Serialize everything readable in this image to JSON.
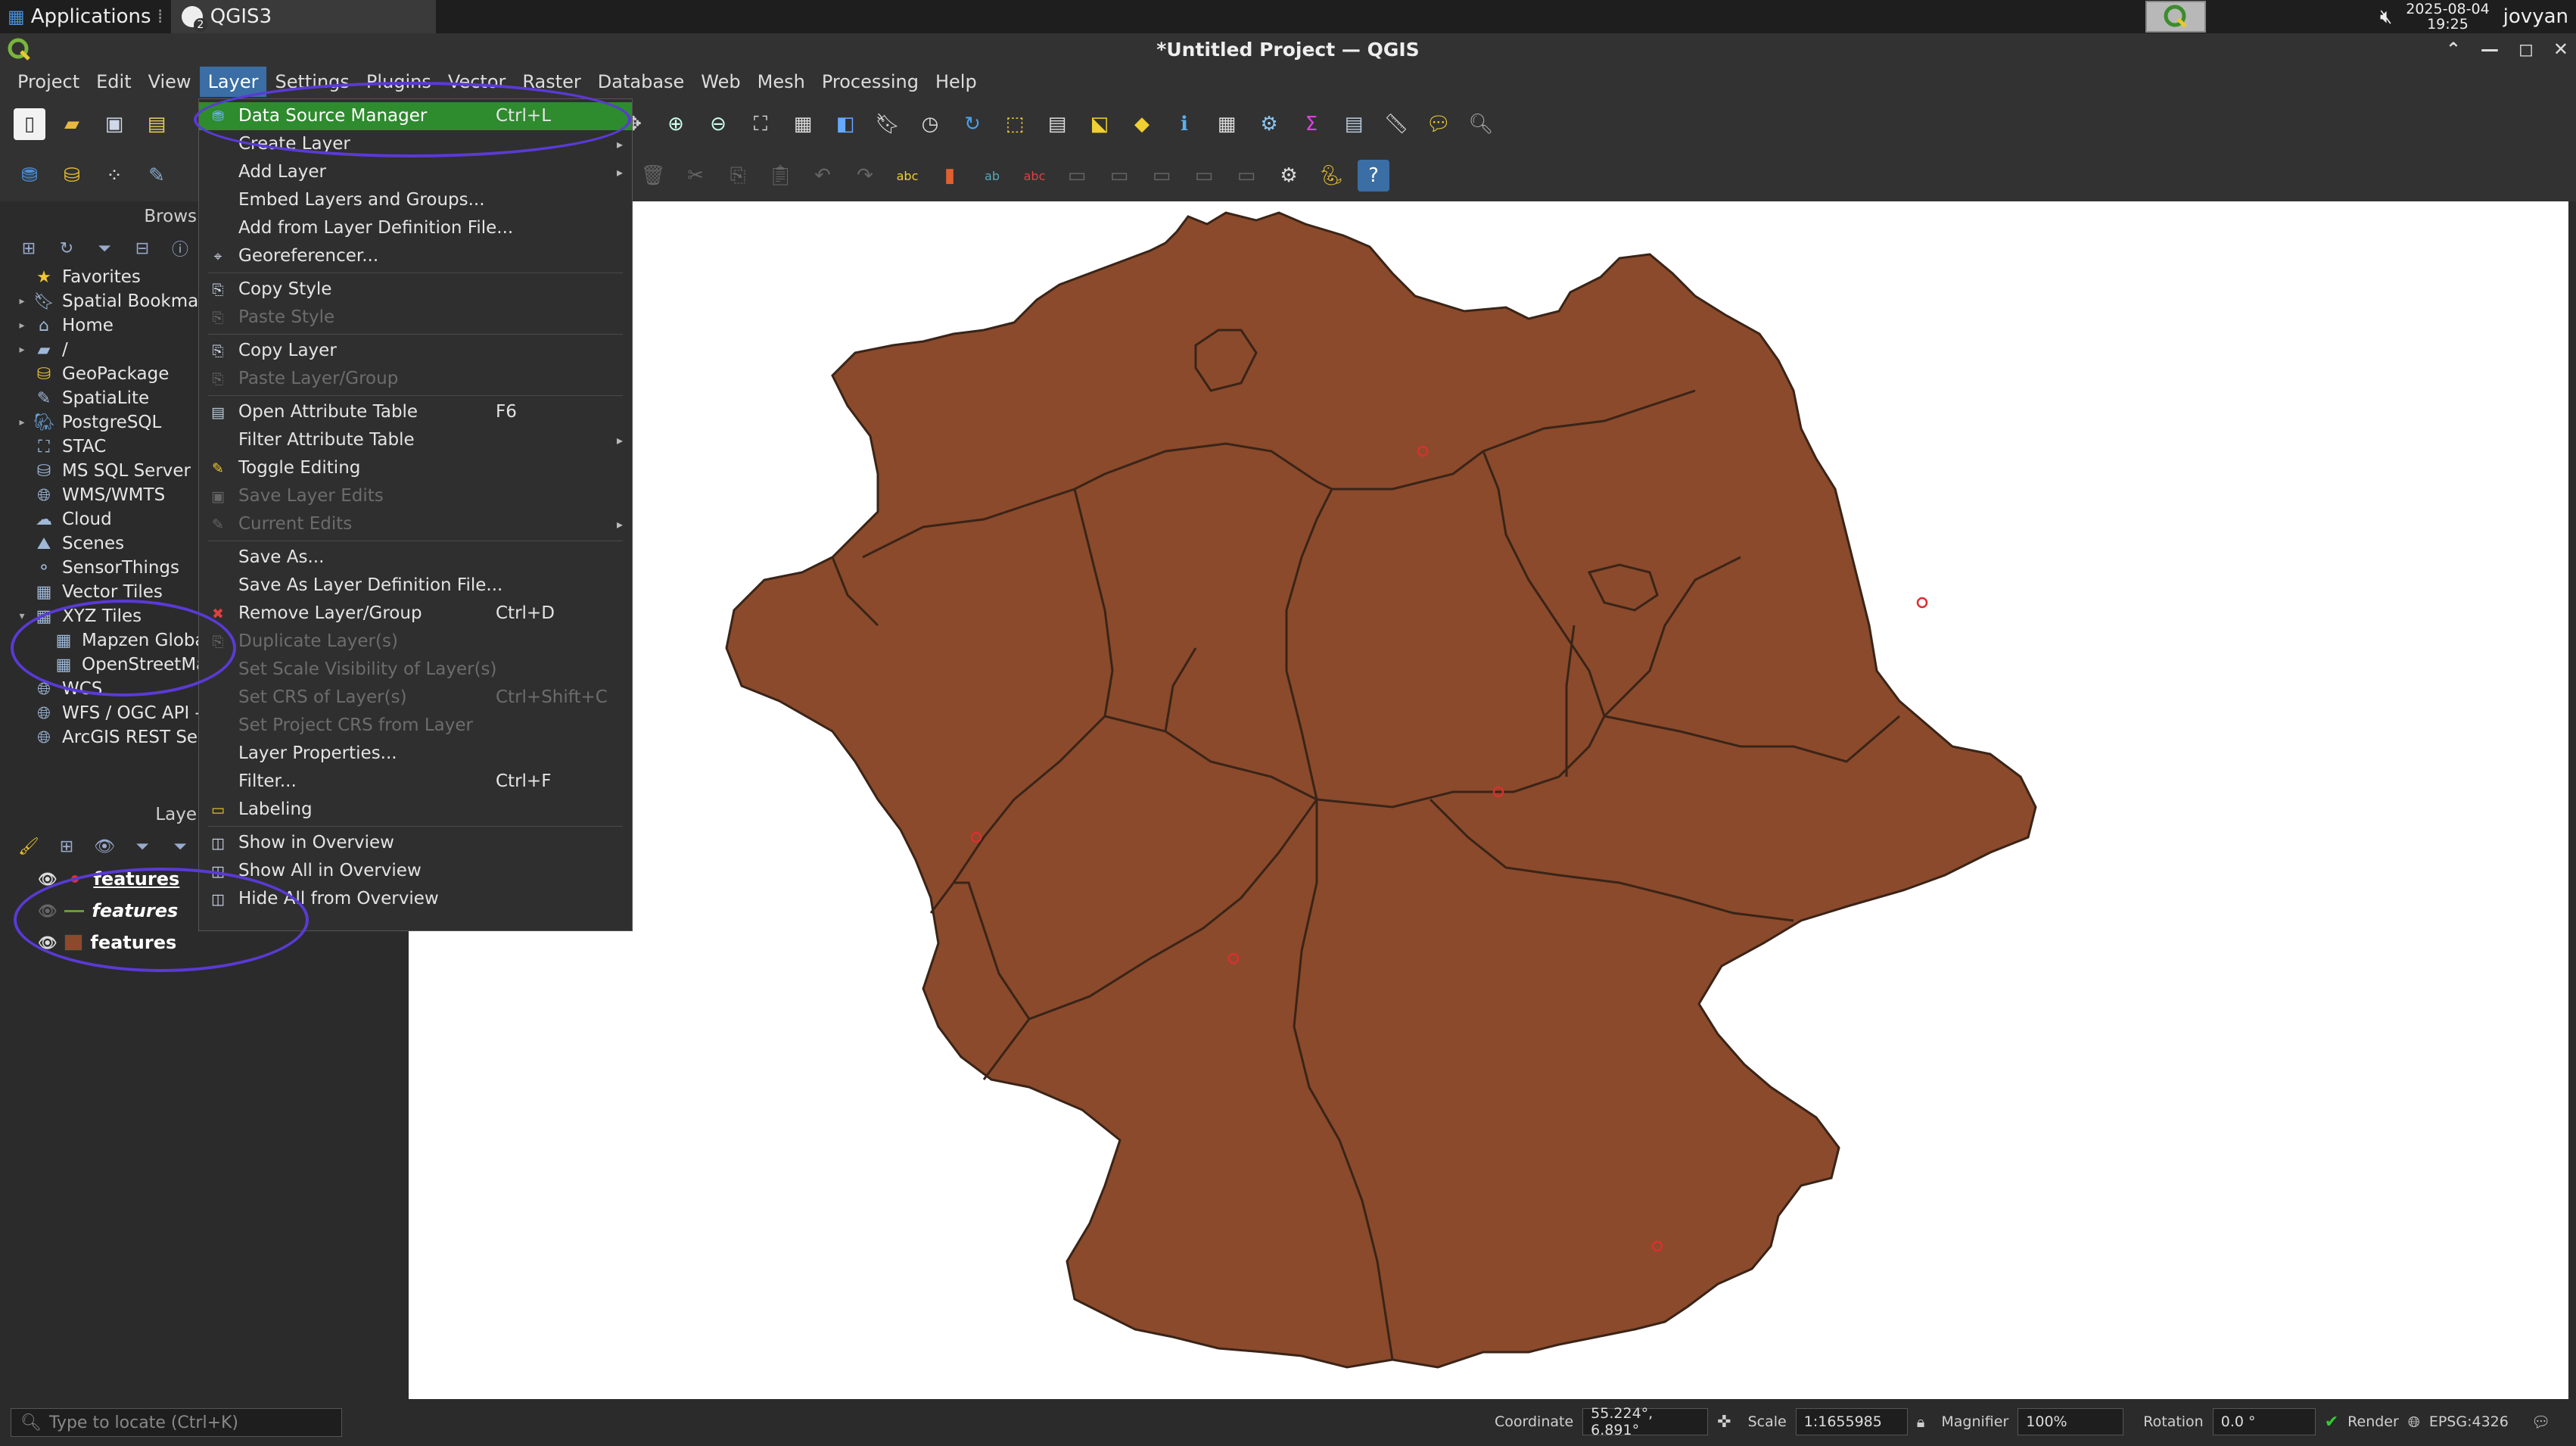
{
  "taskbar": {
    "applications_label": "Applications",
    "task_label": "QGIS3",
    "task_badge": "2",
    "date": "2025-08-04",
    "time": "19:25",
    "user": "jovyan"
  },
  "window": {
    "title": "*Untitled Project — QGIS"
  },
  "menubar": {
    "items": [
      "Project",
      "Edit",
      "View",
      "Layer",
      "Settings",
      "Plugins",
      "Vector",
      "Raster",
      "Database",
      "Web",
      "Mesh",
      "Processing",
      "Help"
    ],
    "active": "Layer"
  },
  "browser_panel": {
    "title": "Brows",
    "items": [
      {
        "label": "Favorites",
        "icon": "star-icon",
        "arrow": ""
      },
      {
        "label": "Spatial Bookmar",
        "icon": "bookmark-icon",
        "arrow": "▸"
      },
      {
        "label": "Home",
        "icon": "home-icon",
        "arrow": "▸"
      },
      {
        "label": "/",
        "icon": "folder-icon",
        "arrow": "▸"
      },
      {
        "label": "GeoPackage",
        "icon": "geopackage-icon",
        "arrow": ""
      },
      {
        "label": "SpatiaLite",
        "icon": "spatialite-icon",
        "arrow": ""
      },
      {
        "label": "PostgreSQL",
        "icon": "postgresql-icon",
        "arrow": "▸"
      },
      {
        "label": "STAC",
        "icon": "stac-icon",
        "arrow": ""
      },
      {
        "label": "MS SQL Server",
        "icon": "mssql-icon",
        "arrow": ""
      },
      {
        "label": "WMS/WMTS",
        "icon": "wms-icon",
        "arrow": ""
      },
      {
        "label": "Cloud",
        "icon": "cloud-icon",
        "arrow": ""
      },
      {
        "label": "Scenes",
        "icon": "scenes-icon",
        "arrow": ""
      },
      {
        "label": "SensorThings",
        "icon": "sensorthings-icon",
        "arrow": ""
      },
      {
        "label": "Vector Tiles",
        "icon": "vector-tiles-icon",
        "arrow": ""
      },
      {
        "label": "XYZ Tiles",
        "icon": "xyz-tiles-icon",
        "arrow": "▾"
      },
      {
        "label": "Mapzen Globa",
        "icon": "grid-icon",
        "arrow": "",
        "indent": true
      },
      {
        "label": "OpenStreetMa",
        "icon": "grid-icon",
        "arrow": "",
        "indent": true
      },
      {
        "label": "WCS",
        "icon": "wcs-icon",
        "arrow": ""
      },
      {
        "label": "WFS / OGC API -",
        "icon": "wfs-icon",
        "arrow": ""
      },
      {
        "label": "ArcGIS REST Ser",
        "icon": "arcgis-icon",
        "arrow": ""
      }
    ]
  },
  "layers_panel": {
    "title": "Laye",
    "layers": [
      {
        "label": "features",
        "type": "point",
        "visible": true
      },
      {
        "label": "features",
        "type": "line",
        "visible": false
      },
      {
        "label": "features",
        "type": "polygon",
        "visible": true
      }
    ]
  },
  "layer_menu": {
    "items": [
      {
        "label": "Data Source Manager",
        "shortcut": "Ctrl+L",
        "state": "highlighted",
        "icon": "data-source-manager-icon"
      },
      {
        "label": "Create Layer",
        "submenu": true,
        "state": "normal"
      },
      {
        "label": "Add Layer",
        "submenu": true,
        "state": "normal"
      },
      {
        "label": "Embed Layers and Groups...",
        "state": "normal"
      },
      {
        "label": "Add from Layer Definition File...",
        "state": "normal"
      },
      {
        "label": "Georeferencer...",
        "state": "normal",
        "icon": "georeferencer-icon"
      },
      {
        "sep": true
      },
      {
        "label": "Copy Style",
        "state": "normal",
        "icon": "copy-style-icon"
      },
      {
        "label": "Paste Style",
        "state": "disabled",
        "icon": "paste-style-icon"
      },
      {
        "sep": true
      },
      {
        "label": "Copy Layer",
        "state": "normal",
        "icon": "copy-layer-icon"
      },
      {
        "label": "Paste Layer/Group",
        "state": "disabled",
        "icon": "paste-layer-icon"
      },
      {
        "sep": true
      },
      {
        "label": "Open Attribute Table",
        "shortcut": "F6",
        "state": "normal",
        "icon": "attribute-table-icon"
      },
      {
        "label": "Filter Attribute Table",
        "submenu": true,
        "state": "normal"
      },
      {
        "label": "Toggle Editing",
        "state": "normal",
        "icon": "pencil-icon"
      },
      {
        "label": "Save Layer Edits",
        "state": "disabled",
        "icon": "save-edits-icon"
      },
      {
        "label": "Current Edits",
        "submenu": true,
        "state": "disabled",
        "icon": "current-edits-icon"
      },
      {
        "sep": true
      },
      {
        "label": "Save As...",
        "state": "normal"
      },
      {
        "label": "Save As Layer Definition File...",
        "state": "normal"
      },
      {
        "label": "Remove Layer/Group",
        "shortcut": "Ctrl+D",
        "state": "normal",
        "icon": "remove-layer-icon"
      },
      {
        "label": "Duplicate Layer(s)",
        "state": "disabled",
        "icon": "duplicate-layer-icon"
      },
      {
        "label": "Set Scale Visibility of Layer(s)",
        "state": "disabled"
      },
      {
        "label": "Set CRS of Layer(s)",
        "shortcut": "Ctrl+Shift+C",
        "state": "disabled"
      },
      {
        "label": "Set Project CRS from Layer",
        "state": "disabled"
      },
      {
        "label": "Layer Properties...",
        "state": "normal"
      },
      {
        "label": "Filter...",
        "shortcut": "Ctrl+F",
        "state": "normal"
      },
      {
        "label": "Labeling",
        "state": "normal",
        "icon": "labeling-icon"
      },
      {
        "sep": true
      },
      {
        "label": "Show in Overview",
        "state": "normal",
        "icon": "show-overview-icon"
      },
      {
        "label": "Show All in Overview",
        "state": "normal",
        "icon": "show-all-overview-icon"
      },
      {
        "label": "Hide All from Overview",
        "state": "normal",
        "icon": "hide-all-overview-icon"
      }
    ]
  },
  "map": {
    "fill_color": "#8b4a2b",
    "stroke_color": "#3a2418",
    "background": "#ffffff"
  },
  "statusbar": {
    "locator_placeholder": "Type to locate (Ctrl+K)",
    "coordinate_label": "Coordinate",
    "coordinate_value": "55.224°, 6.891°",
    "scale_label": "Scale",
    "scale_value": "1:1655985",
    "magnifier_label": "Magnifier",
    "magnifier_value": "100%",
    "rotation_label": "Rotation",
    "rotation_value": "0.0 °",
    "render_label": "Render",
    "crs_label": "EPSG:4326"
  },
  "colors": {
    "accent_highlight": "#2e8b2e",
    "annotation": "#5a3ad6"
  }
}
